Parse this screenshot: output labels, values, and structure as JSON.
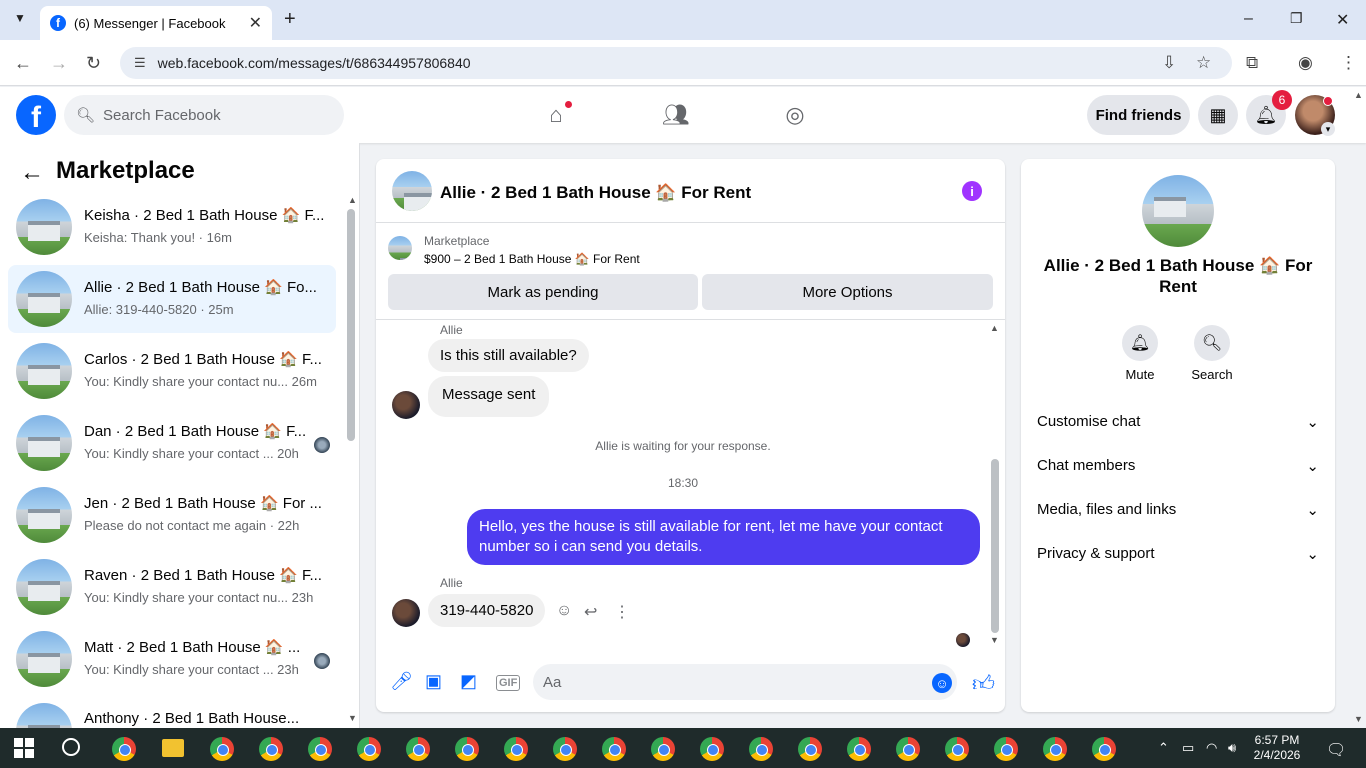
{
  "browser": {
    "tab_title": "(6) Messenger | Facebook",
    "url": "web.facebook.com/messages/t/686344957806840"
  },
  "header": {
    "search_placeholder": "Search Facebook",
    "find_friends": "Find friends",
    "notification_count": "6"
  },
  "sidebar": {
    "title": "Marketplace",
    "conversations": [
      {
        "name": "Keisha · 2 Bed 1 Bath House 🏠 F...",
        "preview": "Keisha: Thank you! · 16m",
        "active": false
      },
      {
        "name": "Allie · 2 Bed 1 Bath House 🏠 Fo...",
        "preview": "Allie: 319-440-5820 · 25m",
        "active": true
      },
      {
        "name": "Carlos · 2 Bed 1 Bath House 🏠 F...",
        "preview": "You: Kindly share your contact nu... 26m",
        "active": false
      },
      {
        "name": "Dan · 2 Bed 1 Bath House 🏠 F...",
        "preview": "You: Kindly share your contact ... 20h",
        "active": false
      },
      {
        "name": "Jen · 2 Bed 1 Bath House 🏠 For ...",
        "preview": "Please do not contact me again · 22h",
        "active": false
      },
      {
        "name": "Raven · 2 Bed 1 Bath House 🏠 F...",
        "preview": "You: Kindly share your contact nu... 23h",
        "active": false
      },
      {
        "name": "Matt · 2 Bed 1 Bath House 🏠 ...",
        "preview": "You: Kindly share your contact ... 23h",
        "active": false
      },
      {
        "name": "Anthony · 2 Bed 1 Bath House...",
        "preview": "",
        "active": false
      }
    ]
  },
  "chat": {
    "title": "Allie · 2 Bed 1 Bath House 🏠 For Rent",
    "marketplace_label": "Marketplace",
    "listing": "$900 – 2 Bed 1 Bath House 🏠 For Rent",
    "btn_pending": "Mark as pending",
    "btn_more": "More Options",
    "sender1": "Allie",
    "msg1": "Is this still available?",
    "msg2": "Message sent",
    "waiting": "Allie is waiting for your response.",
    "time": "18:30",
    "outgoing": "Hello, yes the house is still available for rent, let me have your contact number so i can send you  details.",
    "sender2": "Allie",
    "msg3": "319-440-5820",
    "input_placeholder": "Aa"
  },
  "info_panel": {
    "name": "Allie · 2 Bed 1 Bath House 🏠 For Rent",
    "mute": "Mute",
    "search": "Search",
    "sections": [
      "Customise chat",
      "Chat members",
      "Media, files and links",
      "Privacy & support"
    ]
  },
  "taskbar": {
    "time": "6:57 PM",
    "date": "2/4/2026"
  },
  "colors": {
    "brand": "#0866ff",
    "outgoing_bubble": "#4e3cf0",
    "info_icon": "#a033ff",
    "badge": "#e41e3f"
  }
}
